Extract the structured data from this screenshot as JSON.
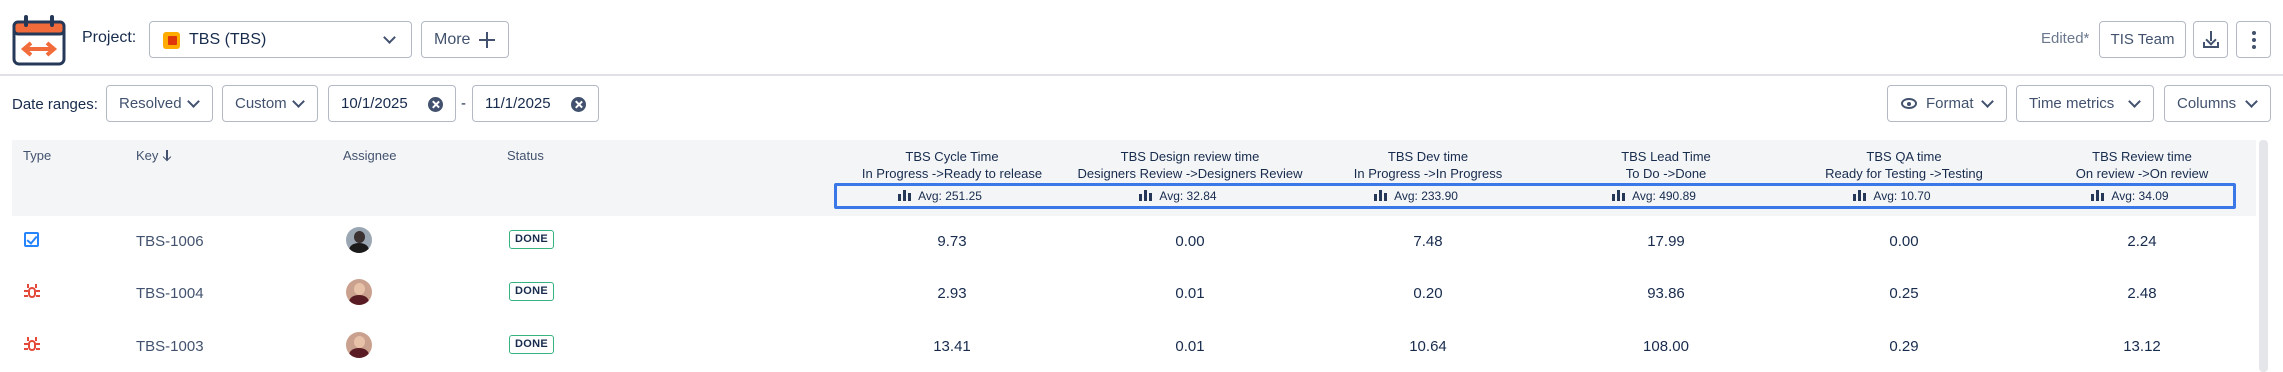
{
  "toolbar": {
    "project_label": "Project:",
    "project_value": "TBS (TBS)",
    "more_label": "More",
    "edited_label": "Edited*",
    "team_label": "TIS Team"
  },
  "filters": {
    "date_ranges_label": "Date ranges:",
    "resolved_label": "Resolved",
    "custom_label": "Custom",
    "start_date": "10/1/2025",
    "dash": "-",
    "end_date": "11/1/2025",
    "format_label": "Format",
    "time_metrics_label": "Time metrics",
    "columns_label": "Columns"
  },
  "table": {
    "headers": {
      "type": "Type",
      "key": "Key",
      "assignee": "Assignee",
      "status": "Status"
    },
    "metrics": [
      {
        "title": "TBS Cycle Time",
        "sub": "In Progress ->Ready to release",
        "avg": "Avg: 251.25"
      },
      {
        "title": "TBS Design review time",
        "sub": "Designers Review ->Designers Review",
        "avg": "Avg: 32.84"
      },
      {
        "title": "TBS Dev time",
        "sub": "In Progress ->In Progress",
        "avg": "Avg: 233.90"
      },
      {
        "title": "TBS Lead Time",
        "sub": "To Do ->Done",
        "avg": "Avg: 490.89"
      },
      {
        "title": "TBS QA time",
        "sub": "Ready for Testing ->Testing",
        "avg": "Avg: 10.70"
      },
      {
        "title": "TBS Review time",
        "sub": "On review ->On review",
        "avg": "Avg: 34.09"
      }
    ],
    "rows": [
      {
        "type_icon": "story-icon",
        "key": "TBS-1006",
        "status": "DONE",
        "values": [
          "9.73",
          "0.00",
          "7.48",
          "17.99",
          "0.00",
          "2.24"
        ]
      },
      {
        "type_icon": "bug-icon",
        "key": "TBS-1004",
        "status": "DONE",
        "values": [
          "2.93",
          "0.01",
          "0.20",
          "93.86",
          "0.25",
          "2.48"
        ]
      },
      {
        "type_icon": "bug-icon",
        "key": "TBS-1003",
        "status": "DONE",
        "values": [
          "13.41",
          "0.01",
          "10.64",
          "108.00",
          "0.29",
          "13.12"
        ]
      }
    ]
  },
  "colors": {
    "accent_blue": "#3b78e7",
    "done_green": "#36b37e",
    "bug_red": "#e5493a",
    "story_blue": "#2684ff",
    "logo_orange": "#f26b3a"
  }
}
